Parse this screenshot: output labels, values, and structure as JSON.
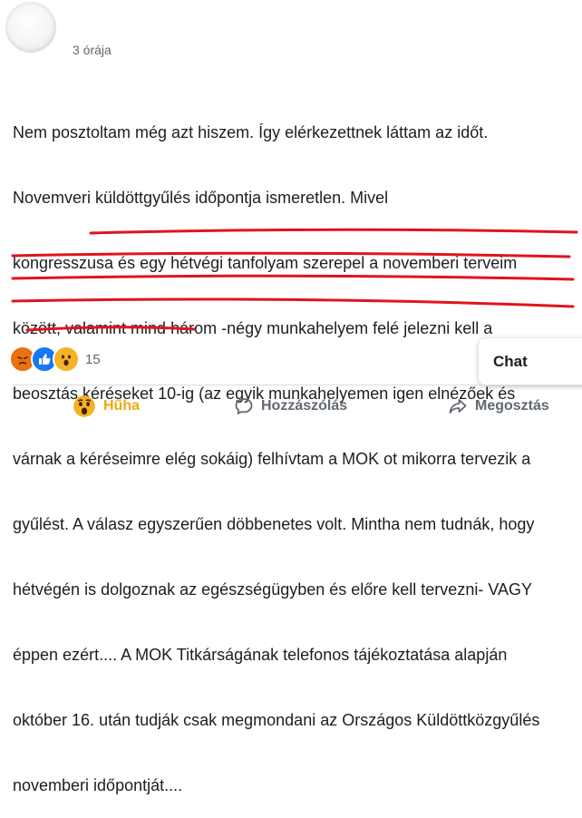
{
  "post": {
    "time": "3 órája",
    "lines": [
      "Nem posztoltam még azt hiszem. Így elérkezettnek láttam az időt.",
      "Novemveri küldöttgyűlés időpontja ismeretlen. Mivel",
      "kongresszusa és egy hétvégi tanfolyam szerepel a novemberi terveim",
      "között, valamint mind három -négy munkahelyem felé jelezni kell a",
      "beosztás kéréseket 10-ig (az egyik munkahelyemen igen elnézőek és",
      "várnak a kéréseimre elég sokáig) felhívtam a MOK ot mikorra tervezik a",
      "gyűlést. A válasz egyszerűen döbbenetes volt. Mintha nem tudnák, hogy",
      "hétvégén is dolgoznak az egészségügyben és előre kell tervezni- VAGY",
      "éppen ezért.... A MOK Titkárságának telefonos tájékoztatása alapján",
      "október 16. után tudják csak megmondani az Országos Küldöttközgyűlés",
      "novemberi időpontját...."
    ]
  },
  "reactions": {
    "count": "15",
    "types": [
      "angry",
      "like",
      "wow"
    ]
  },
  "actions": {
    "wow": "Hűha",
    "comment": "Hozzászólás",
    "share": "Megosztás"
  },
  "chat": {
    "label": "Chat"
  },
  "colors": {
    "underline": "#e0141e",
    "wow_accent": "#f0a70c",
    "like_blue": "#1877f2"
  }
}
